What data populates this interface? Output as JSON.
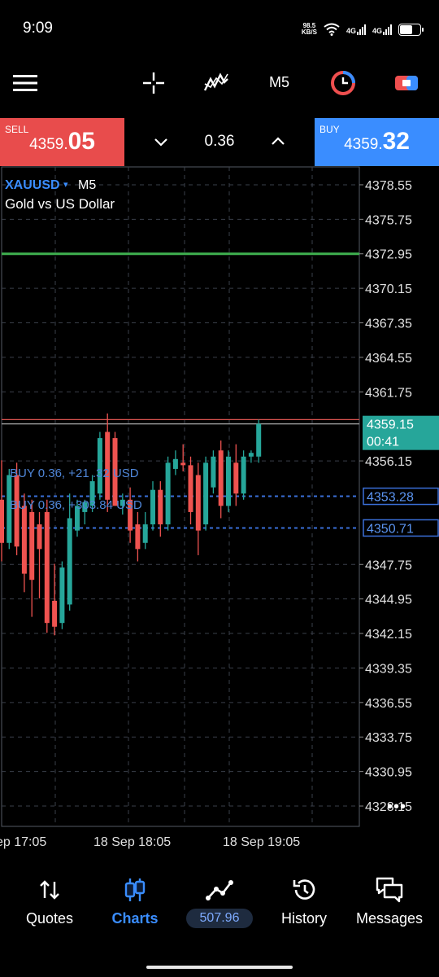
{
  "status_bar": {
    "time": "9:09",
    "speed_value": "98.5",
    "speed_unit": "KB/S",
    "net1": "4G",
    "net2": "4G"
  },
  "toolbar": {
    "menu_icon": "hamburger-menu-icon",
    "crosshair_icon": "crosshair-icon",
    "indicators_icon": "indicators-icon",
    "timeframe": "M5",
    "objects_icon": "objects-icon",
    "trade_icon": "trade-icon"
  },
  "trade_bar": {
    "sell_label": "SELL",
    "sell_price_small": "4359.",
    "sell_price_big": "05",
    "volume": "0.36",
    "buy_label": "BUY",
    "buy_price_small": "4359.",
    "buy_price_big": "32"
  },
  "chart_header": {
    "symbol": "XAUUSD",
    "symbol_caret": "▾",
    "timeframe": "M5",
    "description": "Gold vs US Dollar"
  },
  "positions": [
    {
      "text": "BUY 0.36, +21 .32 USD",
      "price_tag": "4353.28"
    },
    {
      "text": "BUY 0.36, +303.84 USD",
      "price_tag": "4350.71"
    }
  ],
  "current_price": {
    "price": "4359.15",
    "timer": "00:41"
  },
  "chart_data": {
    "type": "candlestick",
    "symbol": "XAUUSD",
    "timeframe": "M5",
    "price_axis_labels": [
      "4378.55",
      "4375.75",
      "4372.95",
      "4370.15",
      "4367.35",
      "4364.55",
      "4361.75",
      "4356.15",
      "4347.75",
      "4344.95",
      "4342.15",
      "4339.35",
      "4336.55",
      "4333.75",
      "4330.95",
      "4328.15"
    ],
    "time_axis_labels": [
      "ep 17:05",
      "18 Sep 18:05",
      "18 Sep 19:05"
    ],
    "ylim": [
      4326.5,
      4380
    ],
    "levels": [
      {
        "price": 4372.95,
        "color": "#3fb04f"
      },
      {
        "price": 4359.5,
        "color": "#d9534f"
      },
      {
        "price": 4359.15,
        "color": "#bbbbbb"
      },
      {
        "price": 4353.28,
        "color": "#3a6fd8",
        "style": "dashed"
      },
      {
        "price": 4350.71,
        "color": "#3a6fd8",
        "style": "dashed"
      }
    ],
    "candles": [
      {
        "o": 4353.0,
        "h": 4356.2,
        "l": 4348.0,
        "c": 4349.5
      },
      {
        "o": 4349.5,
        "h": 4355.5,
        "l": 4349.0,
        "c": 4355.0
      },
      {
        "o": 4355.0,
        "h": 4356.0,
        "l": 4348.5,
        "c": 4349.2
      },
      {
        "o": 4352.5,
        "h": 4353.5,
        "l": 4345.5,
        "c": 4347.0
      },
      {
        "o": 4352.0,
        "h": 4353.0,
        "l": 4343.5,
        "c": 4346.5
      },
      {
        "o": 4351.0,
        "h": 4352.0,
        "l": 4345.0,
        "c": 4349.0
      },
      {
        "o": 4352.0,
        "h": 4353.0,
        "l": 4342.2,
        "c": 4343.0
      },
      {
        "o": 4344.8,
        "h": 4347.8,
        "l": 4342.0,
        "c": 4342.7
      },
      {
        "o": 4343.0,
        "h": 4348.0,
        "l": 4342.5,
        "c": 4347.5
      },
      {
        "o": 4344.5,
        "h": 4353.5,
        "l": 4344.0,
        "c": 4351.5
      },
      {
        "o": 4350.5,
        "h": 4353.0,
        "l": 4350.0,
        "c": 4352.5
      },
      {
        "o": 4352.0,
        "h": 4353.0,
        "l": 4351.0,
        "c": 4352.8
      },
      {
        "o": 4352.5,
        "h": 4355.0,
        "l": 4352.0,
        "c": 4354.5
      },
      {
        "o": 4353.5,
        "h": 4358.5,
        "l": 4353.0,
        "c": 4358.0
      },
      {
        "o": 4358.5,
        "h": 4360.0,
        "l": 4352.0,
        "c": 4353.0
      },
      {
        "o": 4358.0,
        "h": 4358.5,
        "l": 4353.0,
        "c": 4352.5
      },
      {
        "o": 4352.5,
        "h": 4353.5,
        "l": 4351.8,
        "c": 4353.0
      },
      {
        "o": 4353.0,
        "h": 4354.0,
        "l": 4349.5,
        "c": 4350.5
      },
      {
        "o": 4351.0,
        "h": 4352.0,
        "l": 4348.0,
        "c": 4349.0
      },
      {
        "o": 4349.5,
        "h": 4352.0,
        "l": 4349.0,
        "c": 4351.0
      },
      {
        "o": 4351.0,
        "h": 4354.5,
        "l": 4350.5,
        "c": 4353.8
      },
      {
        "o": 4353.8,
        "h": 4354.5,
        "l": 4350.0,
        "c": 4351.0
      },
      {
        "o": 4351.0,
        "h": 4356.5,
        "l": 4350.5,
        "c": 4356.0
      },
      {
        "o": 4355.5,
        "h": 4357.0,
        "l": 4355.0,
        "c": 4356.3
      },
      {
        "o": 4356.0,
        "h": 4357.5,
        "l": 4355.3,
        "c": 4355.8
      },
      {
        "o": 4355.8,
        "h": 4356.5,
        "l": 4351.0,
        "c": 4352.0
      },
      {
        "o": 4355.0,
        "h": 4356.0,
        "l": 4348.5,
        "c": 4350.5
      },
      {
        "o": 4351.0,
        "h": 4356.5,
        "l": 4350.5,
        "c": 4356.0
      },
      {
        "o": 4354.0,
        "h": 4357.0,
        "l": 4353.5,
        "c": 4356.5
      },
      {
        "o": 4357.0,
        "h": 4357.8,
        "l": 4351.5,
        "c": 4352.5
      },
      {
        "o": 4352.5,
        "h": 4357.0,
        "l": 4352.0,
        "c": 4356.5
      },
      {
        "o": 4356.0,
        "h": 4357.5,
        "l": 4352.5,
        "c": 4353.5
      },
      {
        "o": 4353.5,
        "h": 4357.0,
        "l": 4353.0,
        "c": 4356.5
      },
      {
        "o": 4356.5,
        "h": 4357.0,
        "l": 4356.0,
        "c": 4356.8
      },
      {
        "o": 4356.5,
        "h": 4359.5,
        "l": 4356.0,
        "c": 4359.15
      }
    ],
    "colors": {
      "bull": "#26a69a",
      "bear": "#ef5350",
      "grid": "#3a3f4a"
    }
  },
  "bottom_nav": {
    "quotes": "Quotes",
    "charts": "Charts",
    "balance": "507.96",
    "history": "History",
    "messages": "Messages"
  }
}
